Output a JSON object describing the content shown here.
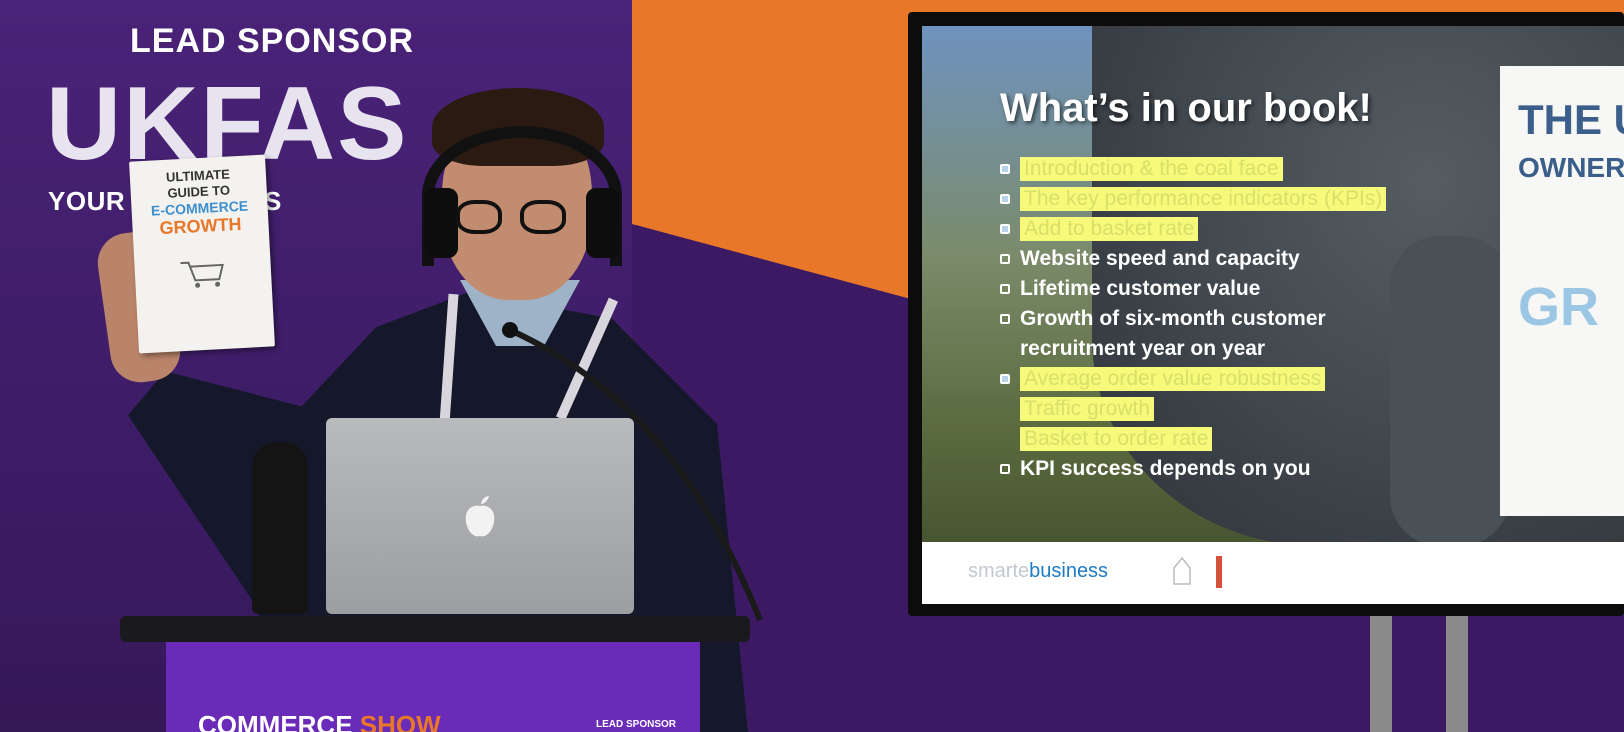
{
  "banner": {
    "lead_sponsor": "LEAD SPONSOR",
    "brand": "UKFAS",
    "tagline": "YOUR    S OUR BUS"
  },
  "book": {
    "line1": "ULTIMATE",
    "line2": "GUIDE TO",
    "line3": "E-COMMERCE",
    "line4": "GROWTH"
  },
  "podium": {
    "event_prefix": "COMMERCE",
    "event_suffix": "SHOW",
    "sponsor": "LEAD SPONSOR"
  },
  "slide": {
    "title": "What’s in our book!",
    "items": [
      {
        "text": "Introduction & the coal face",
        "highlighted": true
      },
      {
        "text": "The key performance indicators (KPIs)",
        "highlighted": true
      },
      {
        "text": "Add to basket rate",
        "highlighted": true
      },
      {
        "text": "Website speed and capacity",
        "highlighted": false
      },
      {
        "text": "Lifetime customer value",
        "highlighted": false
      },
      {
        "text": "Growth of six-month customer",
        "highlighted": false
      },
      {
        "text": "recruitment year on year",
        "highlighted": false,
        "continuation": true
      },
      {
        "text": "Average order value robustness",
        "highlighted": true
      },
      {
        "text": "Traffic growth",
        "highlighted": true,
        "no_bullet": true
      },
      {
        "text": "Basket to order rate",
        "highlighted": true,
        "no_bullet": true
      },
      {
        "text": "KPI success depends on you",
        "highlighted": false
      }
    ],
    "book_thumb": {
      "line1": "THE U",
      "line2": "OWNER",
      "line3": "GR"
    },
    "footer": {
      "brand_prefix": "smarte",
      "brand_suffix": "business"
    }
  },
  "colors": {
    "banner_purple": "#4a2378",
    "accent_orange": "#e8772a",
    "highlight_yellow": "#f6f97a",
    "podium_purple": "#6a2bb8"
  },
  "icons": [
    "shopping-cart-icon",
    "apple-logo-icon",
    "house-logo-icon"
  ]
}
